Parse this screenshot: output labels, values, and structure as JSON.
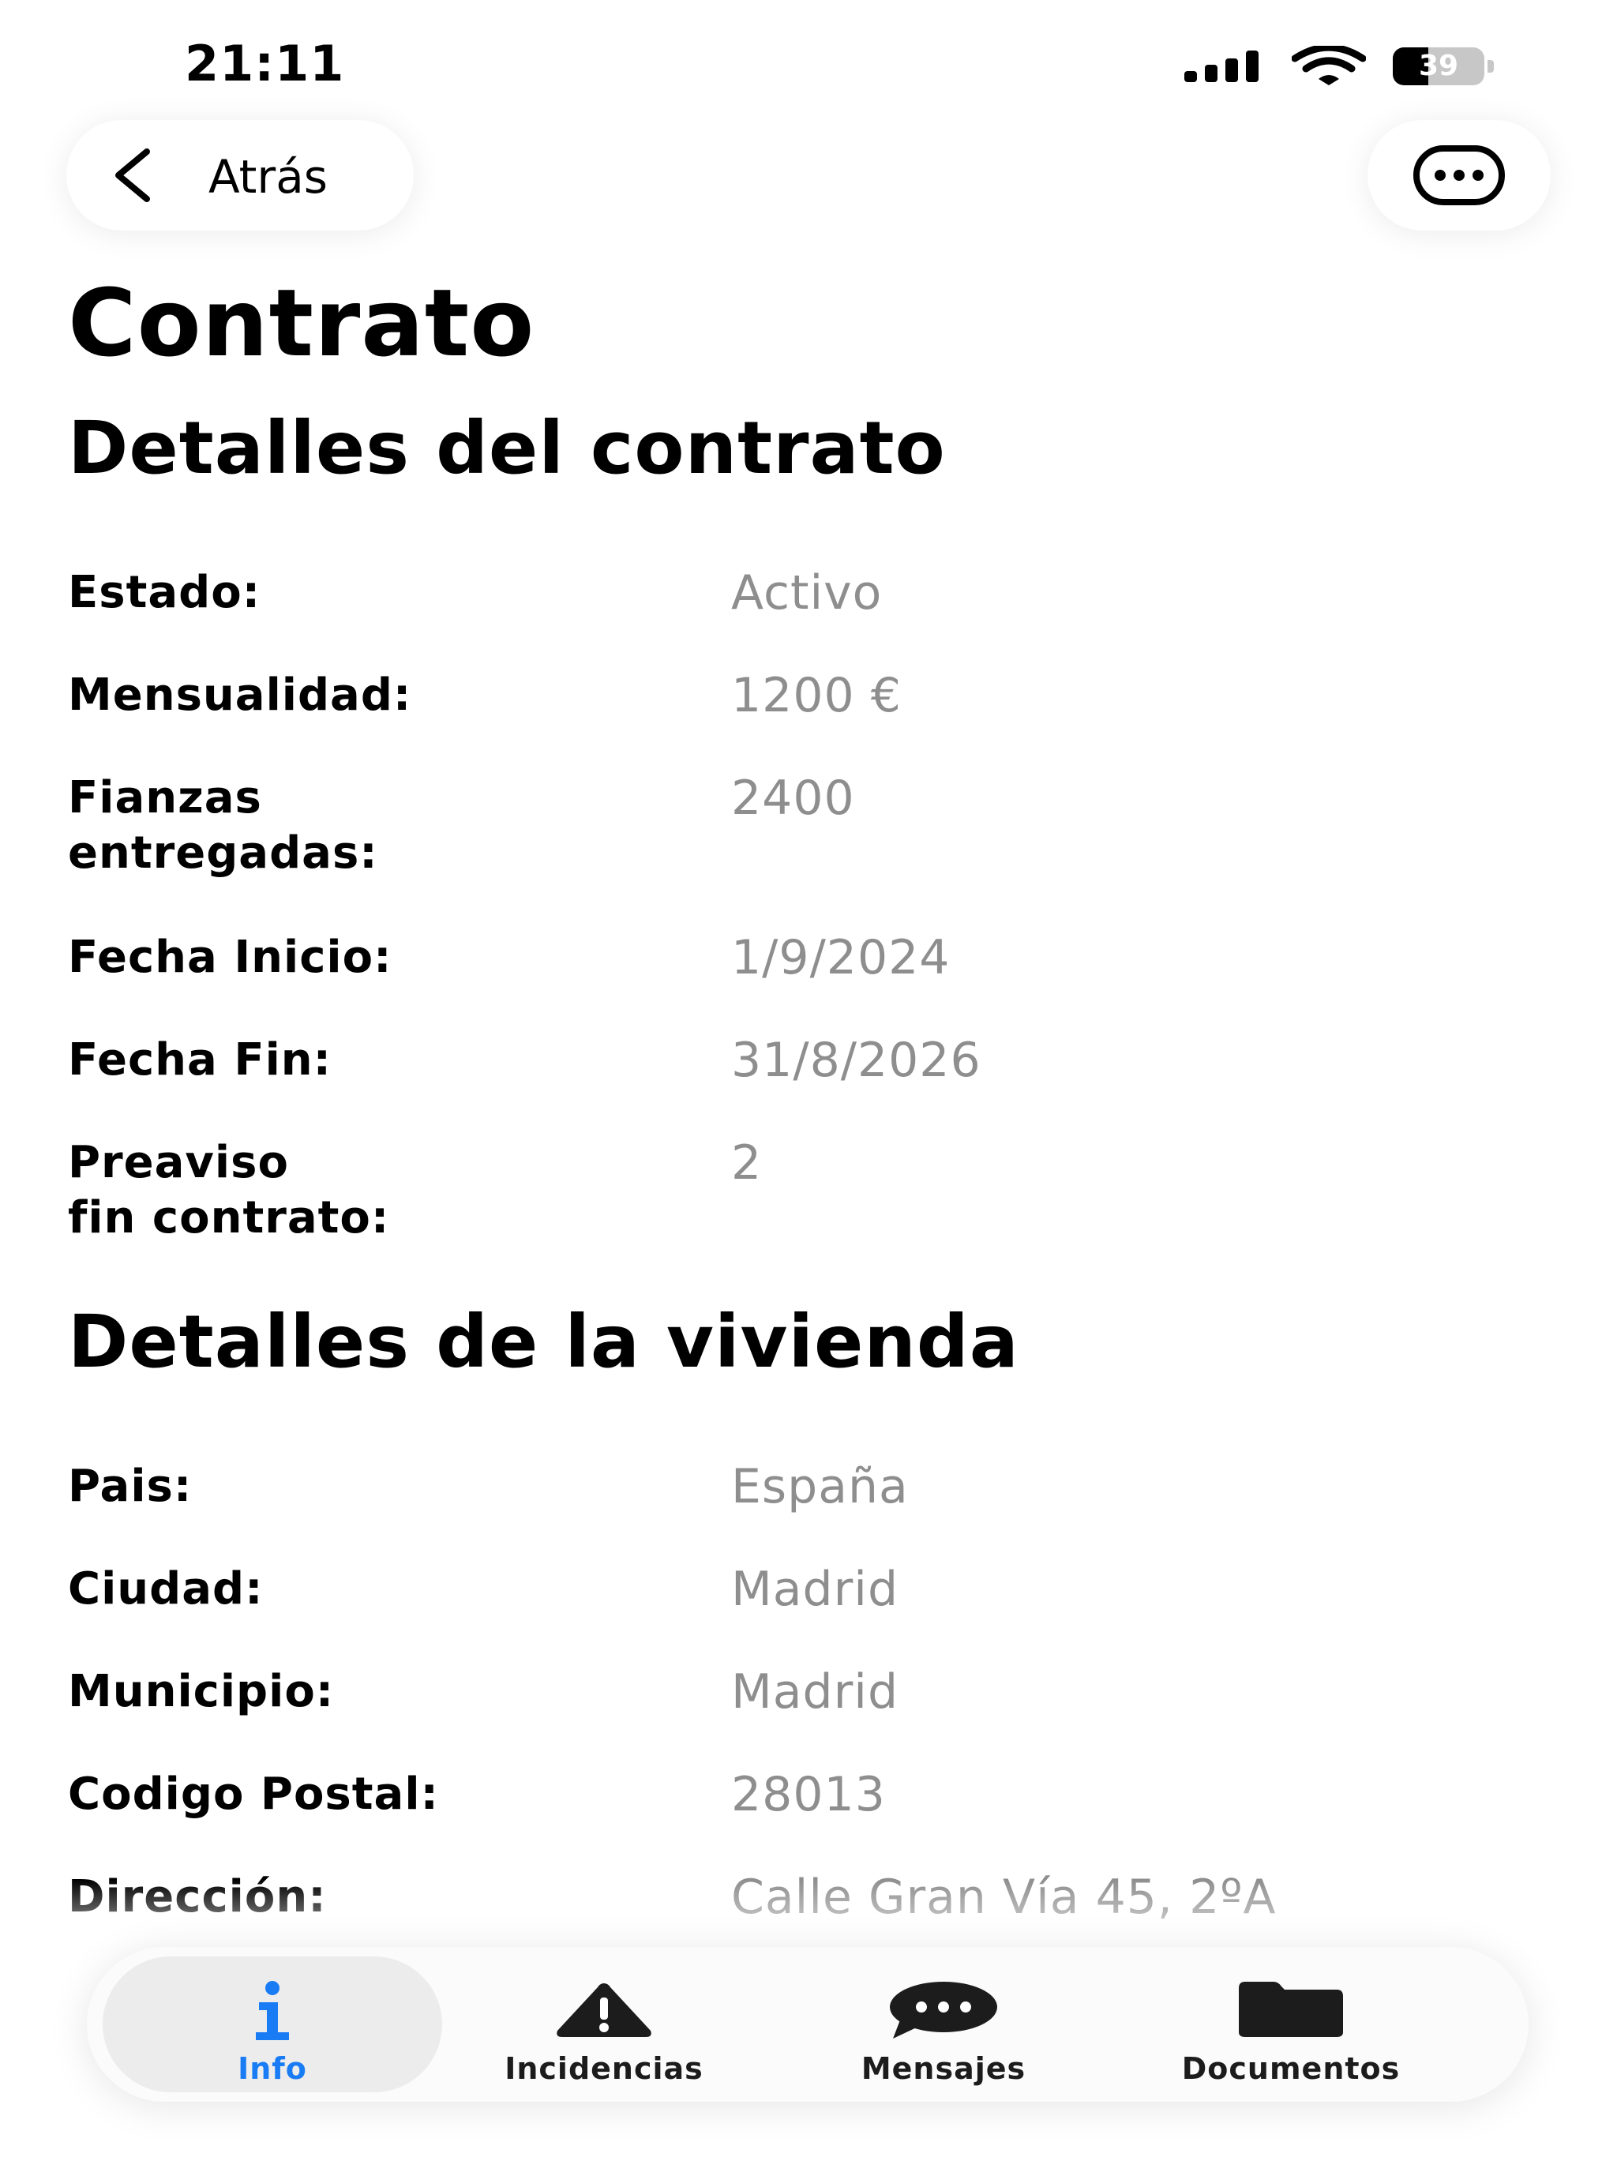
{
  "status_bar": {
    "time": "21:11",
    "battery": "39",
    "battery_level": 0.39
  },
  "header": {
    "back_label": "Atrás",
    "more_icon": "ellipsis-circle-icon"
  },
  "page": {
    "title": "Contrato"
  },
  "contract": {
    "title": "Detalles del contrato",
    "rows": [
      {
        "label": "Estado:",
        "value": "Activo"
      },
      {
        "label": "Mensualidad:",
        "value": "1200 €"
      },
      {
        "label": "Fianzas\nentregadas:",
        "value": "2400"
      },
      {
        "label": "Fecha Inicio:",
        "value": "1/9/2024"
      },
      {
        "label": "Fecha Fin:",
        "value": "31/8/2026"
      },
      {
        "label": "Preaviso\nfin contrato:",
        "value": "2"
      }
    ]
  },
  "home": {
    "title": "Detalles de la vivienda",
    "rows": [
      {
        "label": "Pais:",
        "value": "España"
      },
      {
        "label": "Ciudad:",
        "value": "Madrid"
      },
      {
        "label": "Municipio:",
        "value": "Madrid"
      },
      {
        "label": "Codigo Postal:",
        "value": "28013"
      },
      {
        "label": "Dirección:",
        "value": "Calle Gran Vía 45, 2ºA"
      }
    ]
  },
  "tab_bar": {
    "accent_color": "#1a7cf5",
    "tabs": [
      {
        "label": "Info",
        "icon": "info-icon",
        "active": true
      },
      {
        "label": "Incidencias",
        "icon": "warning-icon",
        "active": false
      },
      {
        "label": "Mensajes",
        "icon": "message-bubble-icon",
        "active": false
      },
      {
        "label": "Documentos",
        "icon": "folder-icon",
        "active": false
      }
    ]
  }
}
